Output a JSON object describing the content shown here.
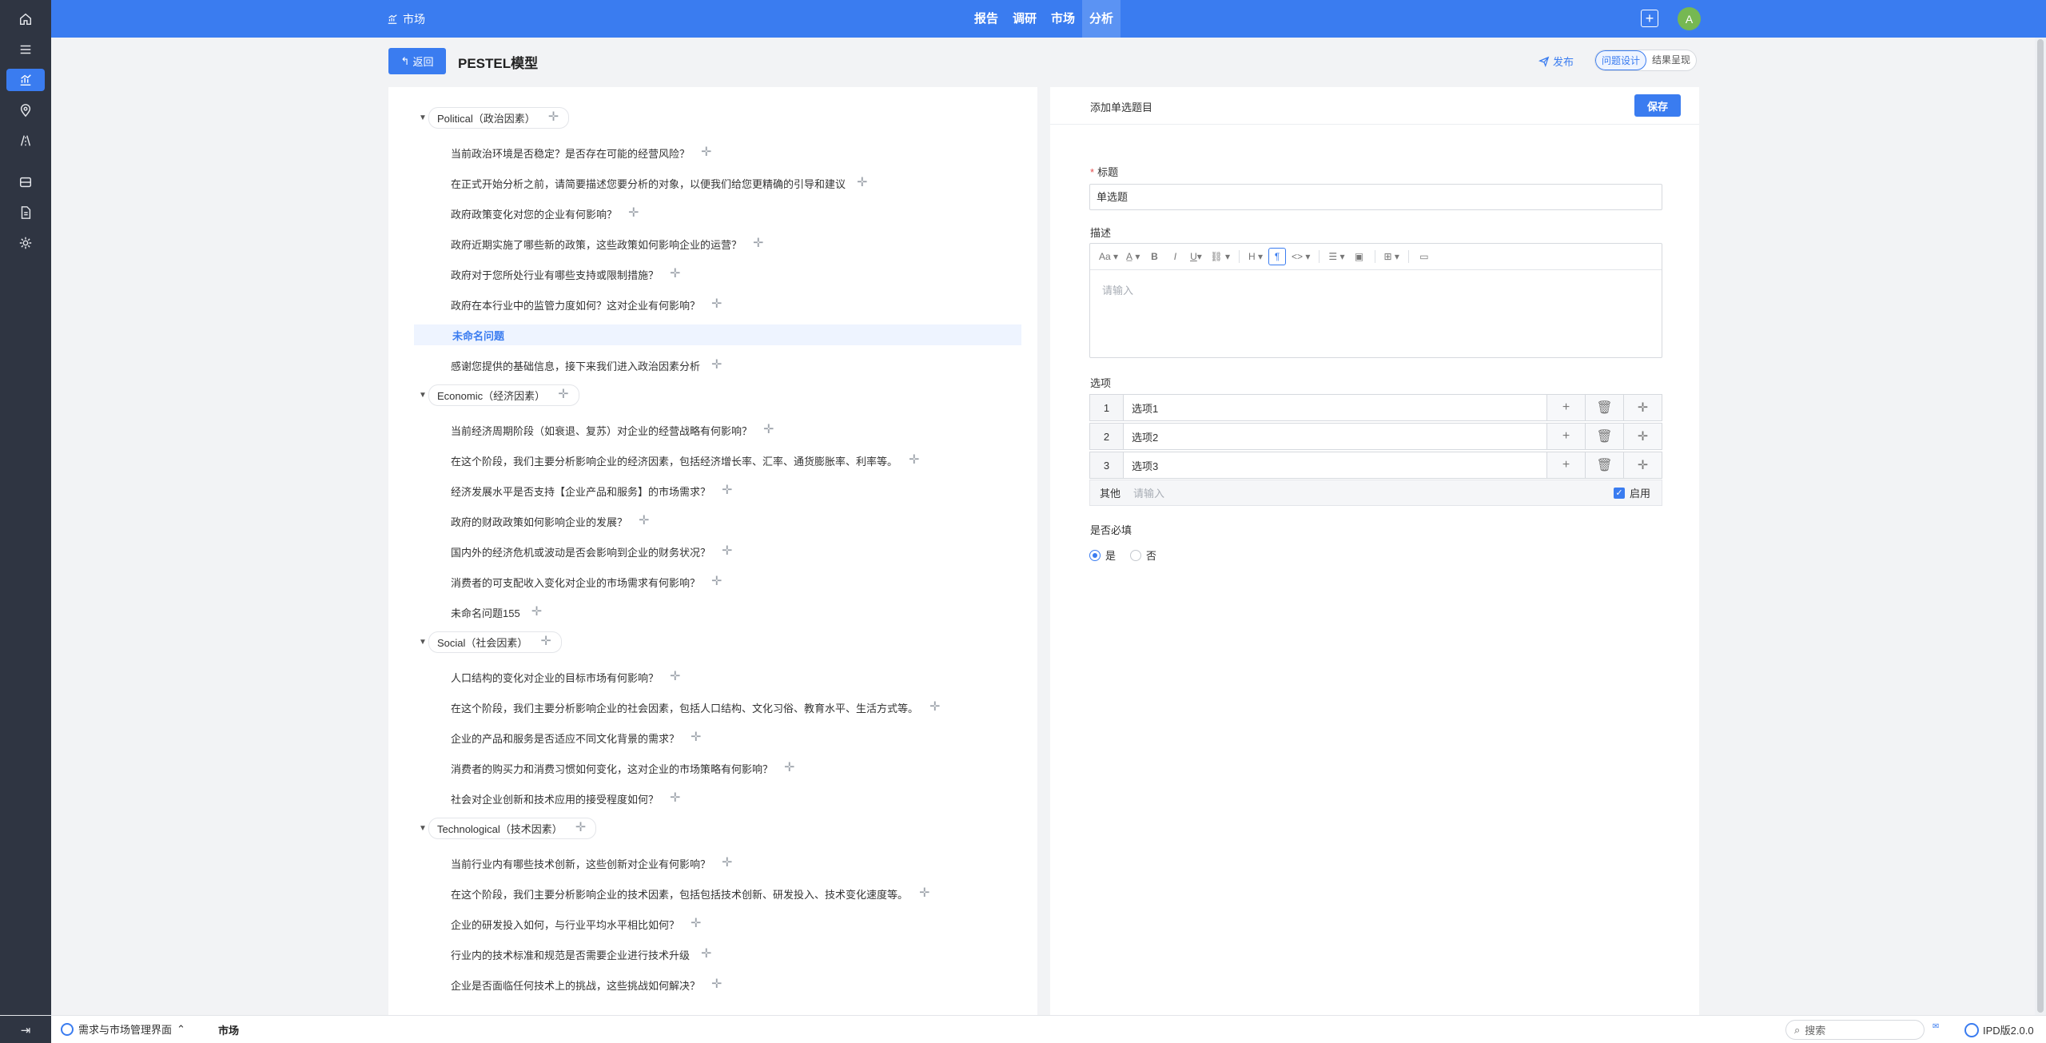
{
  "rail": {
    "icons": [
      "home-icon",
      "menu-icon",
      "chart-icon",
      "location-icon",
      "road-icon",
      "storage-icon",
      "document-icon",
      "settings-icon"
    ]
  },
  "topbar": {
    "breadcrumb": "市场",
    "nav": [
      "报告",
      "调研",
      "市场",
      "分析"
    ],
    "active_nav": "分析",
    "plus": "+",
    "avatar": "A"
  },
  "header": {
    "back_label": "返回",
    "title": "PESTEL模型",
    "publish_label": "发布",
    "segments": [
      "问题设计",
      "结果呈现"
    ]
  },
  "tree": {
    "groups": [
      {
        "label": "Political（政治因素）",
        "items": [
          "当前政治环境是否稳定？是否存在可能的经营风险？",
          "在正式开始分析之前，请简要描述您要分析的对象，以便我们给您更精确的引导和建议",
          "政府政策变化对您的企业有何影响？",
          "政府近期实施了哪些新的政策，这些政策如何影响企业的运营？",
          "政府对于您所处行业有哪些支持或限制措施？",
          "政府在本行业中的监管力度如何？这对企业有何影响？",
          "未命名问题",
          "感谢您提供的基础信息，接下来我们进入政治因素分析"
        ]
      },
      {
        "label": "Economic（经济因素）",
        "items": [
          "当前经济周期阶段（如衰退、复苏）对企业的经营战略有何影响？",
          "在这个阶段，我们主要分析影响企业的经济因素，包括经济增长率、汇率、通货膨胀率、利率等。",
          "经济发展水平是否支持【企业产品和服务】的市场需求？",
          "政府的财政政策如何影响企业的发展？",
          "国内外的经济危机或波动是否会影响到企业的财务状况？",
          "消费者的可支配收入变化对企业的市场需求有何影响？",
          "未命名问题155"
        ]
      },
      {
        "label": "Social（社会因素）",
        "items": [
          "人口结构的变化对企业的目标市场有何影响？",
          "在这个阶段，我们主要分析影响企业的社会因素，包括人口结构、文化习俗、教育水平、生活方式等。",
          "企业的产品和服务是否适应不同文化背景的需求？",
          "消费者的购买力和消费习惯如何变化，这对企业的市场策略有何影响？",
          "社会对企业创新和技术应用的接受程度如何？"
        ]
      },
      {
        "label": "Technological（技术因素）",
        "items": [
          "当前行业内有哪些技术创新，这些创新对企业有何影响？",
          "在这个阶段，我们主要分析影响企业的技术因素，包括包括技术创新、研发投入、技术变化速度等。",
          "企业的研发投入如何，与行业平均水平相比如何？",
          "行业内的技术标准和规范是否需要企业进行技术升级",
          "企业是否面临任何技术上的挑战，这些挑战如何解决？"
        ]
      }
    ],
    "selected": "未命名问题"
  },
  "form": {
    "panel_title": "添加单选题目",
    "save_label": "保存",
    "title_label": "标题",
    "title_required": "*",
    "title_value": "单选题",
    "desc_label": "描述",
    "desc_placeholder": "请输入",
    "toolbar_icons": [
      "font-size-icon",
      "font-color-icon",
      "bold-icon",
      "italic-icon",
      "underline-icon",
      "link-icon",
      "heading-icon",
      "paragraph-icon",
      "code-icon",
      "list-icon",
      "image-icon",
      "table-icon",
      "fullscreen-icon"
    ],
    "options_label": "选项",
    "options": [
      {
        "index": "1",
        "value": "选项1"
      },
      {
        "index": "2",
        "value": "选项2"
      },
      {
        "index": "3",
        "value": "选项3"
      }
    ],
    "other_label": "其他",
    "other_placeholder": "请输入",
    "other_enable_label": "启用",
    "required_label": "是否必填",
    "required_yes": "是",
    "required_no": "否"
  },
  "bottombar": {
    "collapse_icon": "collapse-icon",
    "app_name": "需求与市场管理界面",
    "tab": "市场",
    "search_placeholder": "搜索",
    "brand": "IPD版2.0.0"
  },
  "colors": {
    "primary": "#3a7cf0",
    "rail": "#2f3542",
    "avatar": "#76b852"
  }
}
